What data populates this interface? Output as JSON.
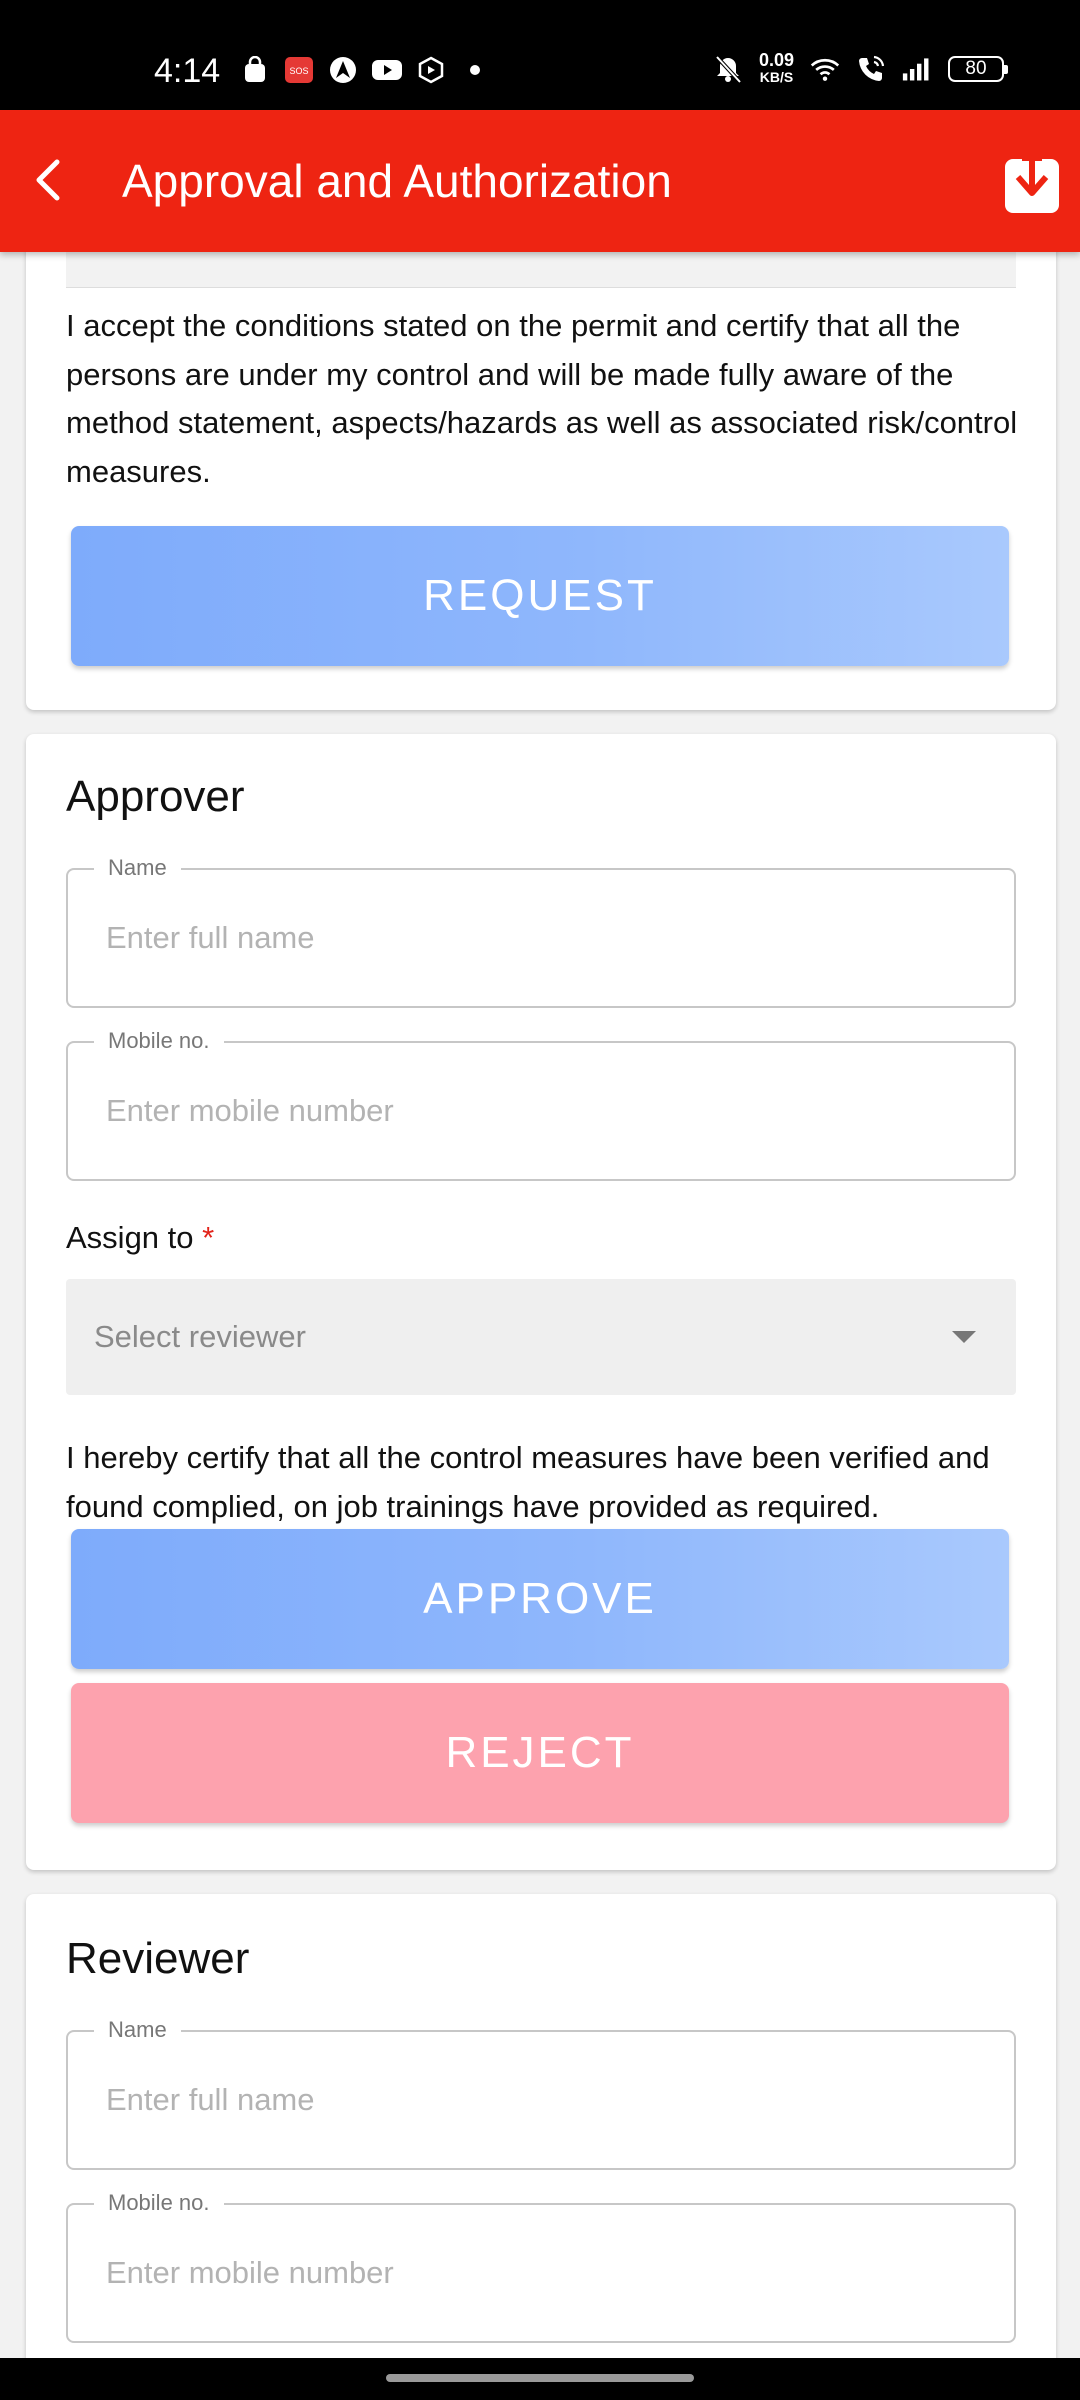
{
  "status_bar": {
    "time": "4:14",
    "net_speed_value": "0.09",
    "net_speed_unit": "KB/S",
    "battery": "80"
  },
  "app_bar": {
    "title": "Approval and Authorization"
  },
  "request_section": {
    "declaration": "I accept the conditions stated on the permit and certify that all the persons are under my control and will be made fully aware of the method statement, aspects/hazards as well as associated risk/control measures.",
    "request_button": "REQUEST"
  },
  "approver_section": {
    "title": "Approver",
    "name_label": "Name",
    "name_placeholder": "Enter full name",
    "mobile_label": "Mobile no.",
    "mobile_placeholder": "Enter mobile number",
    "assign_label": "Assign to",
    "required_mark": "*",
    "assign_placeholder": "Select reviewer",
    "declaration": "I hereby certify that all the control measures have been verified and found complied, on job trainings have provided as required.",
    "approve_button": "APPROVE",
    "reject_button": "REJECT"
  },
  "reviewer_section": {
    "title": "Reviewer",
    "name_label": "Name",
    "name_placeholder": "Enter full name",
    "mobile_label": "Mobile no.",
    "mobile_placeholder": "Enter mobile number"
  },
  "colors": {
    "app_bar": "#ee2412",
    "primary_button": "#8fb7fc",
    "reject_button": "#fda2ae",
    "required": "#e2231a"
  }
}
